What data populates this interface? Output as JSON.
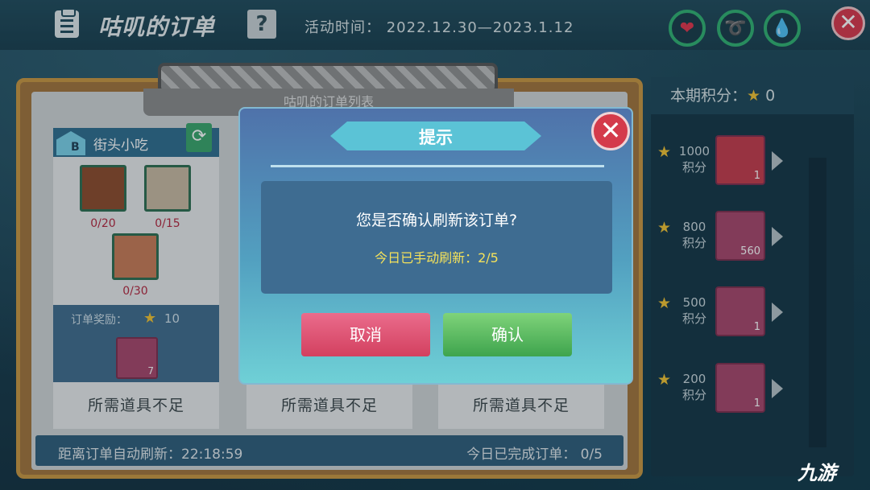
{
  "header": {
    "title": "咕叽的订单",
    "help_label": "?",
    "event_time": "活动时间： 2022.12.30—2023.1.12",
    "close_label": "✕"
  },
  "board": {
    "list_title": "咕叽的订单列表",
    "order": {
      "category": "街头小吃",
      "grade": "B",
      "items": [
        {
          "icon": "pie-icon",
          "count": "0/20"
        },
        {
          "icon": "muffin-icon",
          "count": "0/15"
        },
        {
          "icon": "drumstick-icon",
          "count": "0/30"
        }
      ],
      "reward_label": "订单奖励：",
      "reward_value": "10",
      "reward_item_qty": "7"
    },
    "status_text": "所需道具不足",
    "auto_refresh": "距离订单自动刷新：22:18:59",
    "completed_today": "今日已完成订单： 0/5"
  },
  "score_panel": {
    "title": "本期积分：",
    "current": "0",
    "tiers": [
      {
        "points": "1000",
        "unit": "积分",
        "icon": "cake-icon",
        "qty": "1"
      },
      {
        "points": "800",
        "unit": "积分",
        "icon": "shell-coin-icon",
        "qty": "560"
      },
      {
        "points": "500",
        "unit": "积分",
        "icon": "bird-figure-icon",
        "qty": "1"
      },
      {
        "points": "200",
        "unit": "积分",
        "icon": "flower-pig-icon",
        "qty": "1"
      }
    ]
  },
  "dialog": {
    "title": "提示",
    "message": "您是否确认刷新该订单?",
    "sub_message": "今日已手动刷新：2/5",
    "cancel_label": "取消",
    "confirm_label": "确认"
  },
  "watermark": "九游"
}
